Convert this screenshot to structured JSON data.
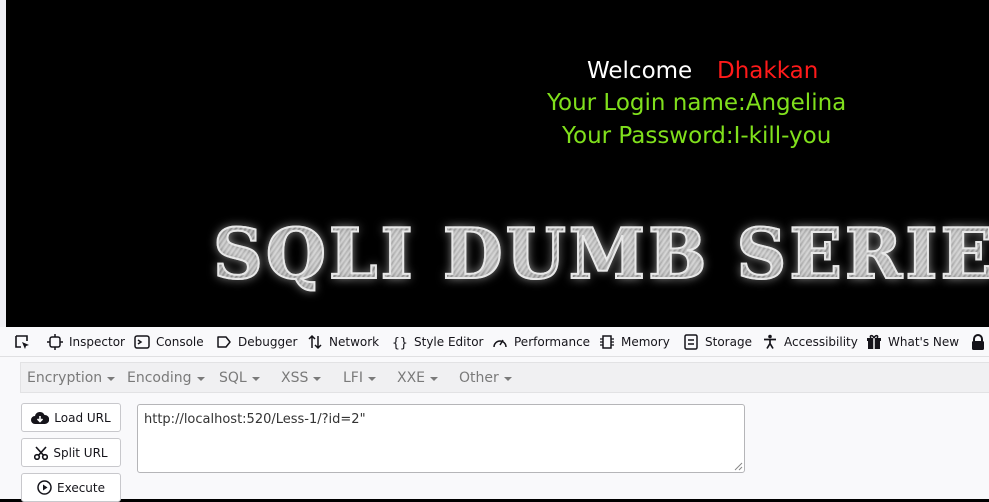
{
  "page": {
    "welcome": "Welcome",
    "username": "Dhakkan",
    "login_line": "Your Login name:Angelina",
    "password_line": "Your Password:I-kill-you",
    "banner": "SQLI DUMB SERIES"
  },
  "devtools": {
    "tabs": {
      "inspector": "Inspector",
      "console": "Console",
      "debugger": "Debugger",
      "network": "Network",
      "style_editor": "Style Editor",
      "performance": "Performance",
      "memory": "Memory",
      "storage": "Storage",
      "accessibility": "Accessibility",
      "whats_new": "What's New"
    }
  },
  "hackbar": {
    "menus": {
      "encryption": "Encryption",
      "encoding": "Encoding",
      "sql": "SQL",
      "xss": "XSS",
      "lfi": "LFI",
      "xxe": "XXE",
      "other": "Other"
    },
    "buttons": {
      "load_url": "Load URL",
      "split_url": "Split URL",
      "execute": "Execute"
    },
    "url_value": "http://localhost:520/Less-1/?id=2\""
  },
  "colors": {
    "background": "#000000",
    "welcome": "#ffffff",
    "username": "#ff1a1a",
    "credentials": "#80e01c",
    "devtools_bg": "#f9f9fb"
  }
}
